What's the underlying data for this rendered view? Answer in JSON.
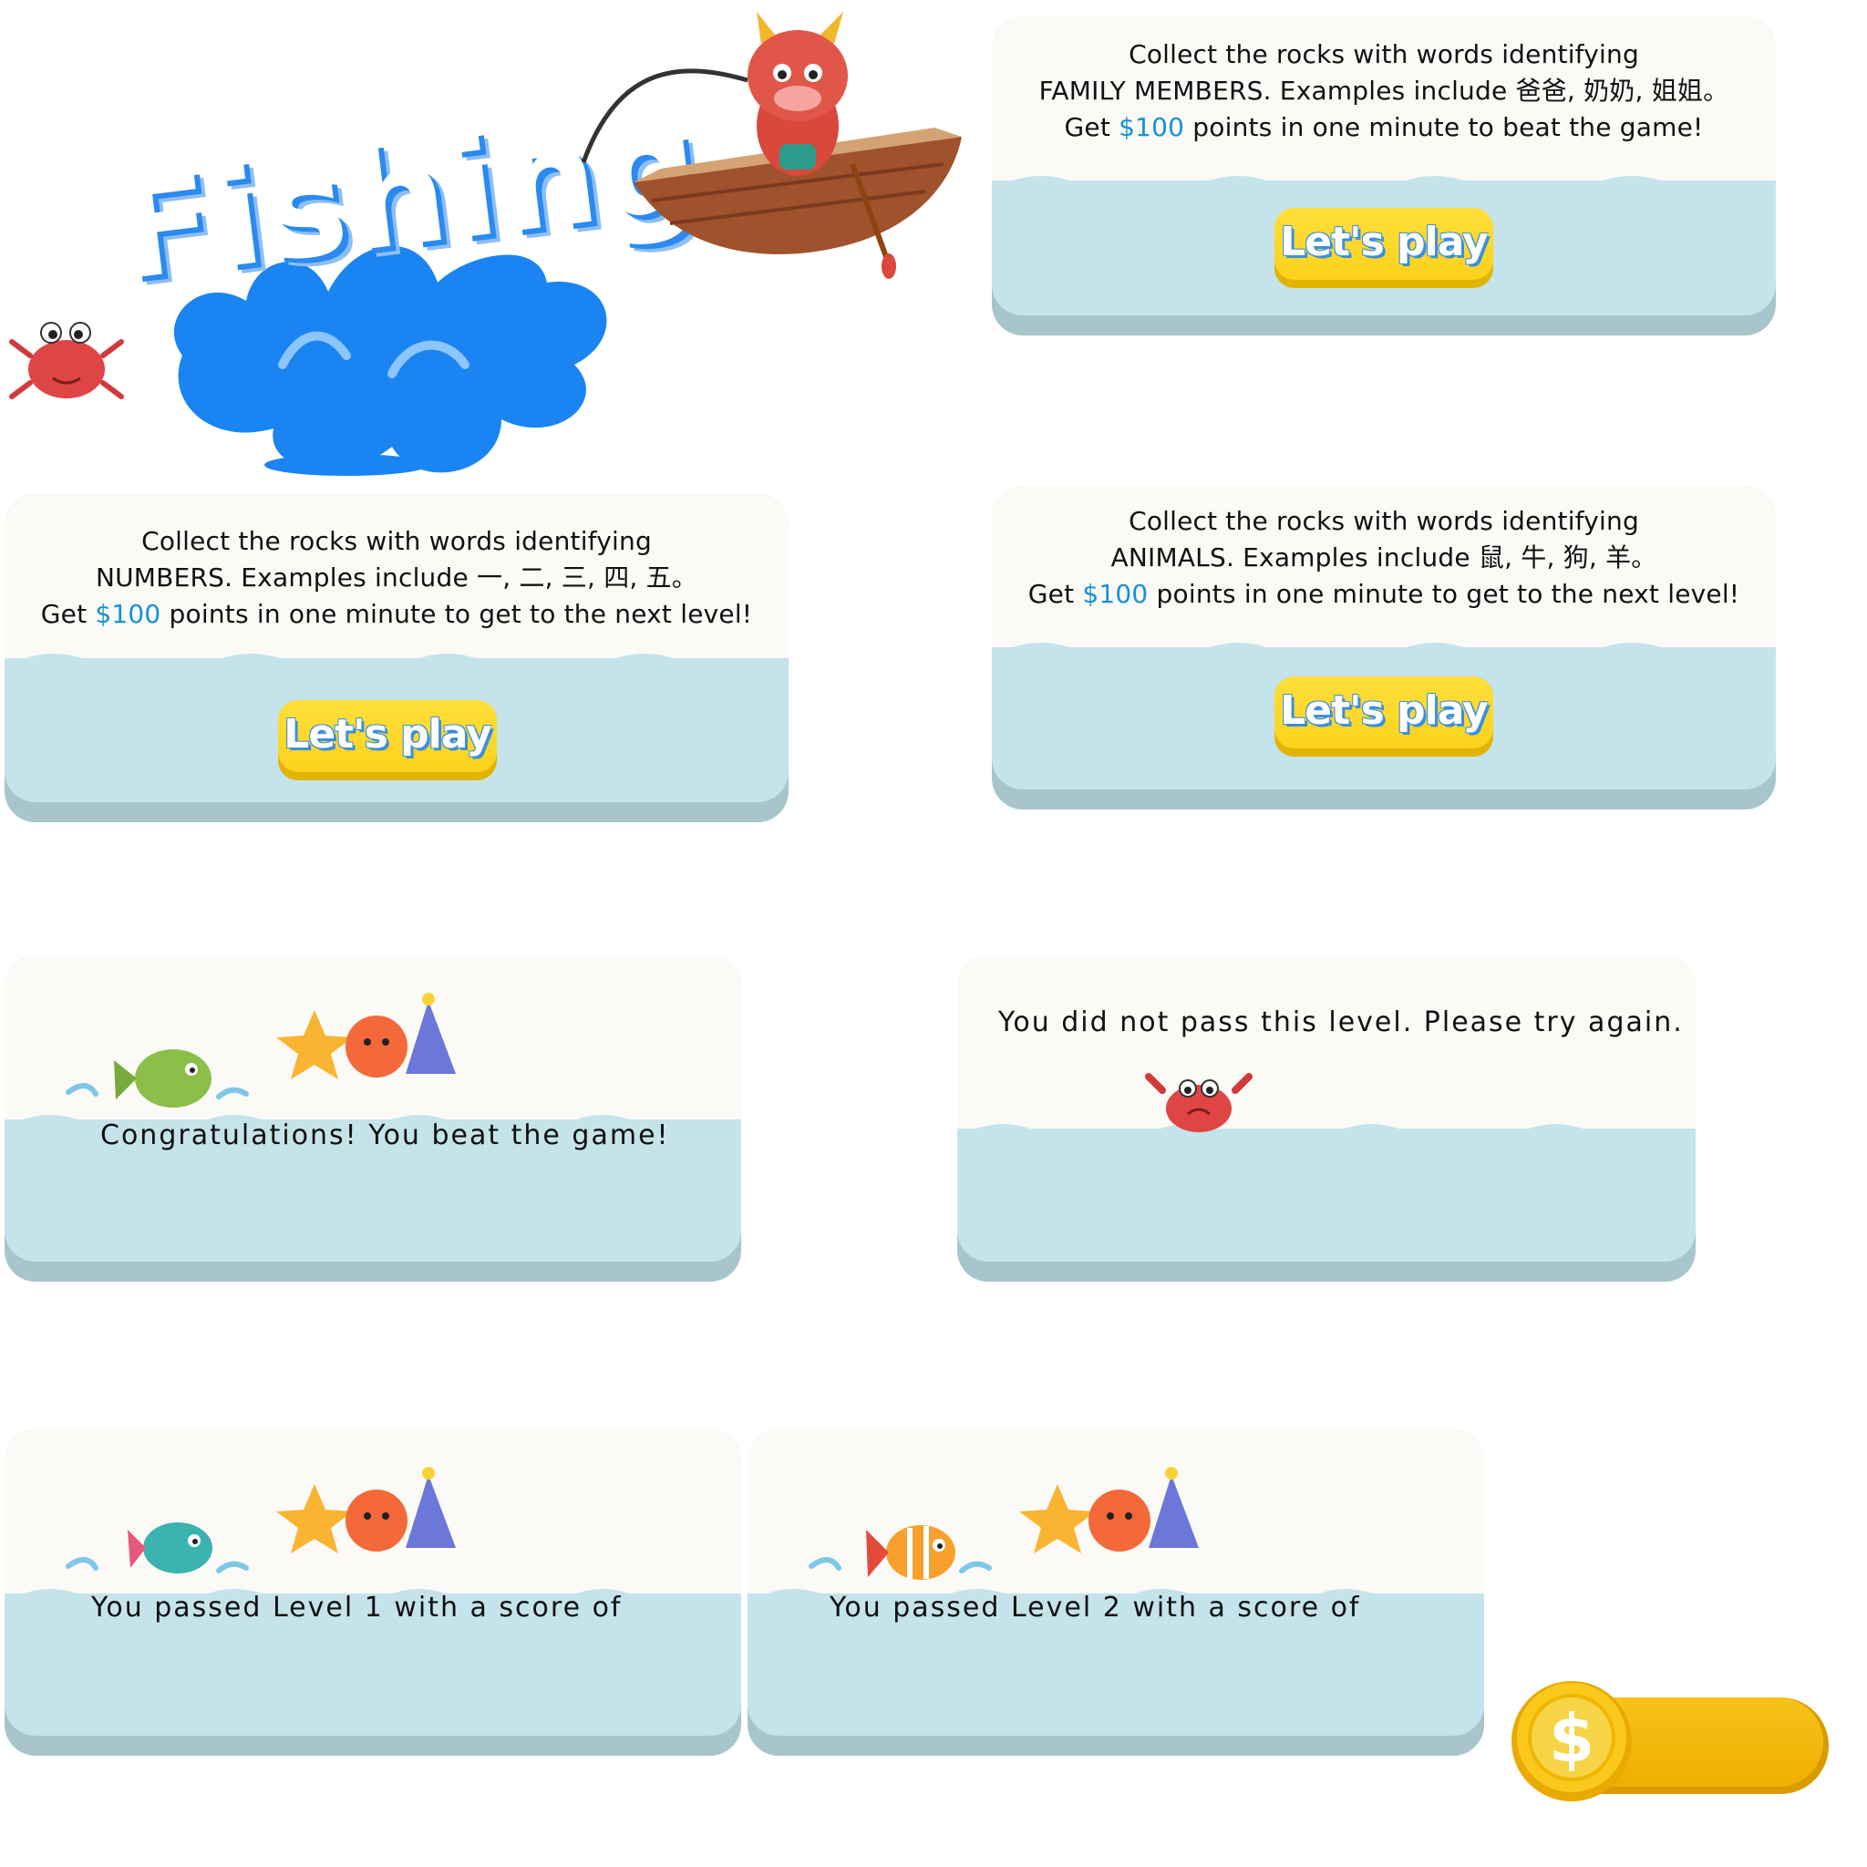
{
  "title": {
    "text": "Fishing"
  },
  "cards": {
    "family": {
      "line1": "Collect the rocks with words identifying",
      "line2": "FAMILY MEMBERS.  Examples include 爸爸, 奶奶, 姐姐。",
      "line3_pre": "Get ",
      "line3_money": "$100",
      "line3_post": " points in one minute to beat the game!",
      "button": "Let's play"
    },
    "numbers": {
      "line1": "Collect the rocks with words identifying",
      "line2": "NUMBERS.  Examples include 一, 二, 三, 四, 五。",
      "line3_pre": "Get ",
      "line3_money": "$100",
      "line3_post": " points in one minute to get to the next level!",
      "button": "Let's play"
    },
    "animals": {
      "line1": "Collect the rocks with words identifying",
      "line2": "ANIMALS.  Examples include 鼠, 牛, 狗, 羊。",
      "line3_pre": "Get ",
      "line3_money": "$100",
      "line3_post": " points in one minute to get to the next level!",
      "button": "Let's play"
    },
    "win": {
      "text": "Congratulations! You beat the game!"
    },
    "fail": {
      "text": "You did not pass this level.  Please try again."
    },
    "level1": {
      "text": "You passed Level 1 with a score of"
    },
    "level2": {
      "text": "You passed Level 2 with a score of"
    }
  },
  "coin": {
    "symbol": "$"
  },
  "colors": {
    "money": "#1691d6",
    "water": "#c5e3ea",
    "card_top": "#fbfaf7",
    "button": "#fcd21c",
    "splash": "#1a84f2"
  },
  "icons": [
    "dragon-fisher-icon",
    "boat-icon",
    "crab-icon",
    "water-splash-icon",
    "fish-icon",
    "party-emoji-icon",
    "sad-crab-icon",
    "coin-icon"
  ]
}
